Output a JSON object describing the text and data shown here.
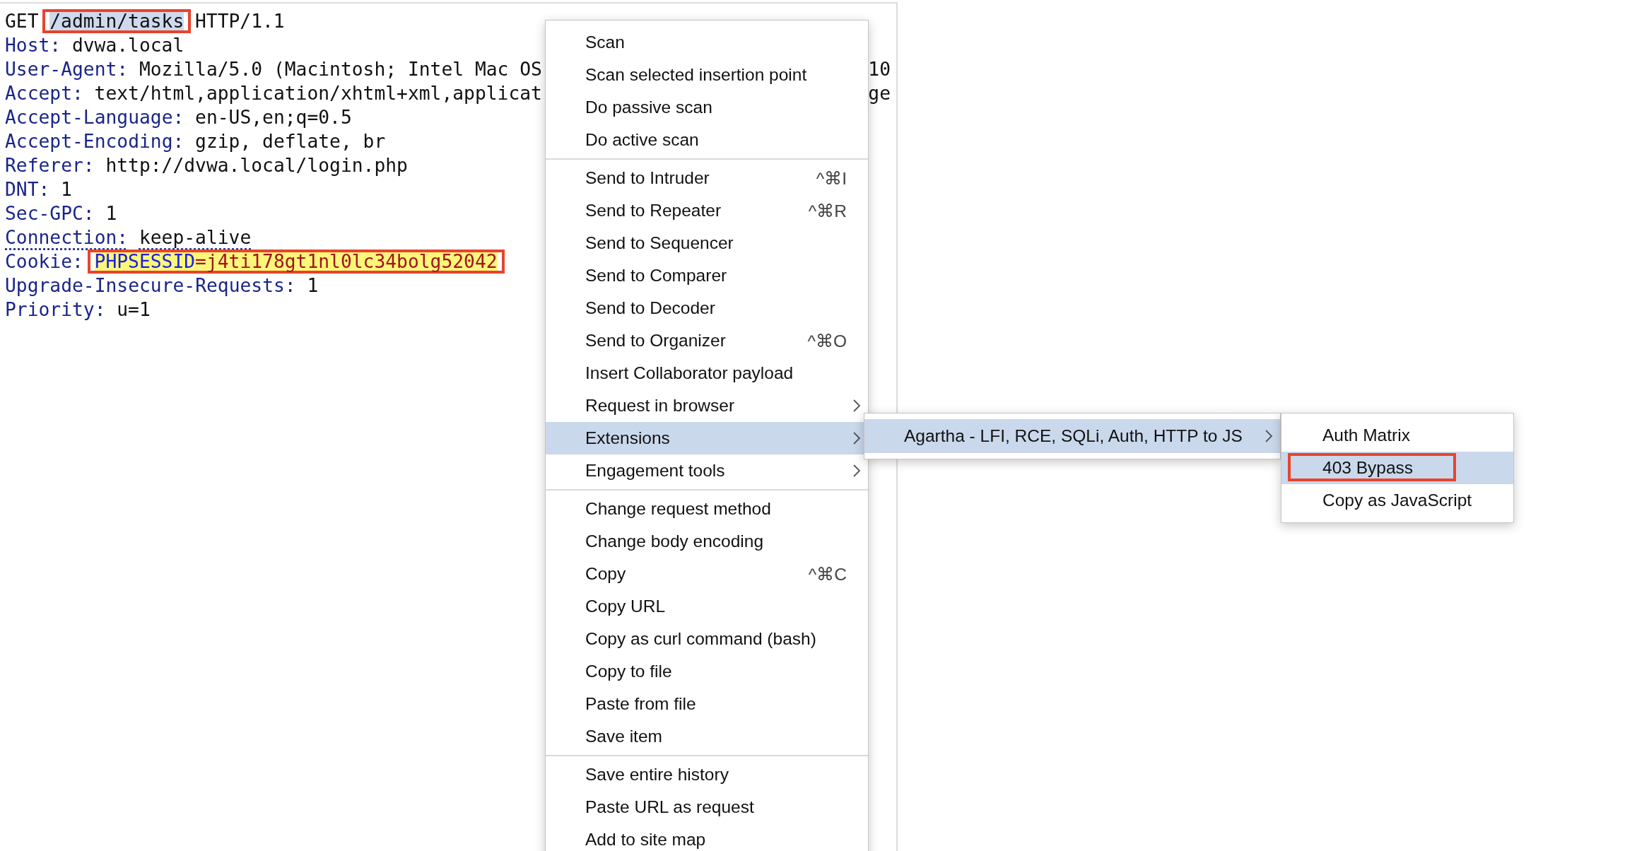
{
  "request": {
    "lines": [
      {
        "kind": "request-line",
        "method": "GET",
        "path": "/admin/tasks",
        "path_selected": true,
        "boxed": true,
        "protocol": "HTTP/1.1"
      },
      {
        "kind": "header",
        "name": "Host:",
        "value": "dvwa.local"
      },
      {
        "kind": "header",
        "name": "User-Agent:",
        "value": "Mozilla/5.0 (Macintosh; Intel Mac OS",
        "tail": "10"
      },
      {
        "kind": "header",
        "name": "Accept:",
        "value": "text/html,application/xhtml+xml,applicat",
        "tail": "ge"
      },
      {
        "kind": "header",
        "name": "Accept-Language:",
        "value": "en-US,en;q=0.5"
      },
      {
        "kind": "header",
        "name": "Accept-Encoding:",
        "value": "gzip, deflate, br"
      },
      {
        "kind": "header",
        "name": "Referer:",
        "value": "http://dvwa.local/login.php"
      },
      {
        "kind": "header",
        "name": "DNT:",
        "value": "1"
      },
      {
        "kind": "header",
        "name": "Sec-GPC:",
        "value": "1"
      },
      {
        "kind": "header",
        "name": "Connection:",
        "value": "keep-alive",
        "underlined": true
      },
      {
        "kind": "cookie",
        "name": "Cookie:",
        "cookie_name": "PHPSESSID",
        "cookie_value": "=j4ti178gt1nl0lc34bolg52042",
        "boxed": true
      },
      {
        "kind": "header",
        "name": "Upgrade-Insecure-Requests:",
        "value": "1"
      },
      {
        "kind": "header",
        "name": "Priority:",
        "value": "u=1"
      }
    ]
  },
  "context_menu": {
    "groups": [
      [
        {
          "label": "Scan",
          "selected": false,
          "has_submenu": false
        },
        {
          "label": "Scan selected insertion point",
          "selected": false,
          "has_submenu": false
        },
        {
          "label": "Do passive scan",
          "selected": false,
          "has_submenu": false
        },
        {
          "label": "Do active scan",
          "selected": false,
          "has_submenu": false
        }
      ],
      [
        {
          "label": "Send to Intruder",
          "shortcut": "^⌘I",
          "selected": false,
          "has_submenu": false
        },
        {
          "label": "Send to Repeater",
          "shortcut": "^⌘R",
          "selected": false,
          "has_submenu": false
        },
        {
          "label": "Send to Sequencer",
          "selected": false,
          "has_submenu": false
        },
        {
          "label": "Send to Comparer",
          "selected": false,
          "has_submenu": false
        },
        {
          "label": "Send to Decoder",
          "selected": false,
          "has_submenu": false
        },
        {
          "label": "Send to Organizer",
          "shortcut": "^⌘O",
          "selected": false,
          "has_submenu": false
        },
        {
          "label": "Insert Collaborator payload",
          "selected": false,
          "has_submenu": false
        },
        {
          "label": "Request in browser",
          "selected": false,
          "has_submenu": true
        },
        {
          "label": "Extensions",
          "selected": true,
          "has_submenu": true
        },
        {
          "label": "Engagement tools",
          "selected": false,
          "has_submenu": true
        }
      ],
      [
        {
          "label": "Change request method",
          "selected": false,
          "has_submenu": false
        },
        {
          "label": "Change body encoding",
          "selected": false,
          "has_submenu": false
        },
        {
          "label": "Copy",
          "shortcut": "^⌘C",
          "selected": false,
          "has_submenu": false
        },
        {
          "label": "Copy URL",
          "selected": false,
          "has_submenu": false
        },
        {
          "label": "Copy as curl command (bash)",
          "selected": false,
          "has_submenu": false
        },
        {
          "label": "Copy to file",
          "selected": false,
          "has_submenu": false
        },
        {
          "label": "Paste from file",
          "selected": false,
          "has_submenu": false
        },
        {
          "label": "Save item",
          "selected": false,
          "has_submenu": false
        }
      ],
      [
        {
          "label": "Save entire history",
          "selected": false,
          "has_submenu": false
        },
        {
          "label": "Paste URL as request",
          "selected": false,
          "has_submenu": false
        },
        {
          "label": "Add to site map",
          "selected": false,
          "has_submenu": false
        }
      ]
    ]
  },
  "extensions_submenu": [
    {
      "label": "Agartha - LFI, RCE, SQLi, Auth, HTTP to JS",
      "selected": true,
      "has_submenu": true
    }
  ],
  "agartha_submenu": [
    {
      "label": "Auth Matrix",
      "selected": false,
      "boxed": false
    },
    {
      "label": "403 Bypass",
      "selected": true,
      "boxed": true
    },
    {
      "label": "Copy as JavaScript",
      "selected": false,
      "boxed": false
    }
  ]
}
